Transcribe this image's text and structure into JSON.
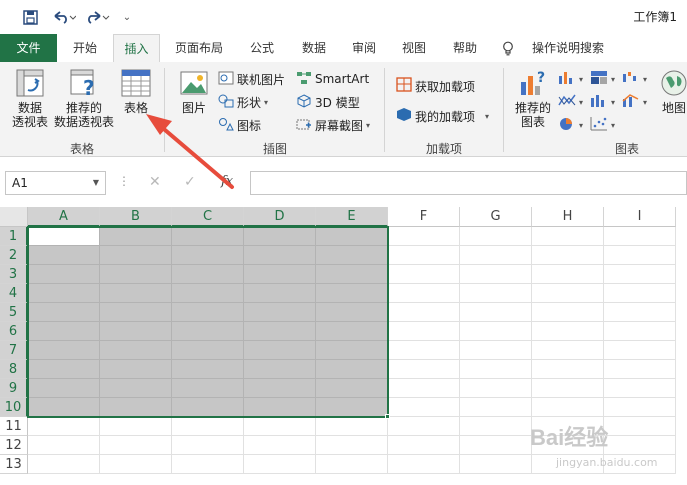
{
  "window": {
    "title": "工作簿1"
  },
  "qat": {
    "more": "⌄"
  },
  "tabs": [
    "文件",
    "开始",
    "插入",
    "页面布局",
    "公式",
    "数据",
    "审阅",
    "视图",
    "帮助"
  ],
  "tell_me": "操作说明搜索",
  "ribbon": {
    "tables_group": {
      "label": "表格",
      "pivot": "数据\n透视表",
      "pivot_l1": "数据",
      "pivot_l2": "透视表",
      "rec_l1": "推荐的",
      "rec_l2": "数据透视表",
      "table": "表格"
    },
    "illus_group": {
      "label": "插图",
      "picture": "图片",
      "online_pic": "联机图片",
      "shapes": "形状",
      "icons": "图标",
      "smartart": "SmartArt",
      "model3d": "3D 模型",
      "screenshot": "屏幕截图"
    },
    "addins_group": {
      "label": "加载项",
      "get": "获取加载项",
      "mine": "我的加载项"
    },
    "charts_group": {
      "label": "图表",
      "rec_l1": "推荐的",
      "rec_l2": "图表",
      "map": "地图"
    }
  },
  "formula_bar": {
    "name_box": "A1",
    "cancel": "✕",
    "enter": "✓",
    "fx": "fx",
    "value": ""
  },
  "columns": [
    "A",
    "B",
    "C",
    "D",
    "E",
    "F",
    "G",
    "H",
    "I"
  ],
  "rows": [
    "1",
    "2",
    "3",
    "4",
    "5",
    "6",
    "7",
    "8",
    "9",
    "10",
    "11",
    "12",
    "13"
  ],
  "selection": {
    "range": "A1:E10",
    "active": "A1"
  },
  "watermark": {
    "brand": "Bai经验",
    "url": "jingyan.baidu.com"
  }
}
